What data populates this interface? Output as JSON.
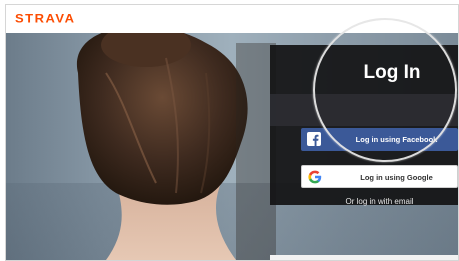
{
  "header": {
    "logo_text": "STRAVA",
    "brand_color": "#fc4c02"
  },
  "login": {
    "title": "Log In",
    "facebook_button": "Log in using Facebook",
    "google_button": "Log in using Google",
    "email_link": "Or log in with email"
  },
  "icons": {
    "facebook": "facebook-f-icon",
    "google": "google-g-icon"
  },
  "colors": {
    "panel_bg": "#121214",
    "facebook_blue": "#3b5998",
    "google_red": "#ea4335",
    "google_blue": "#4285f4"
  }
}
